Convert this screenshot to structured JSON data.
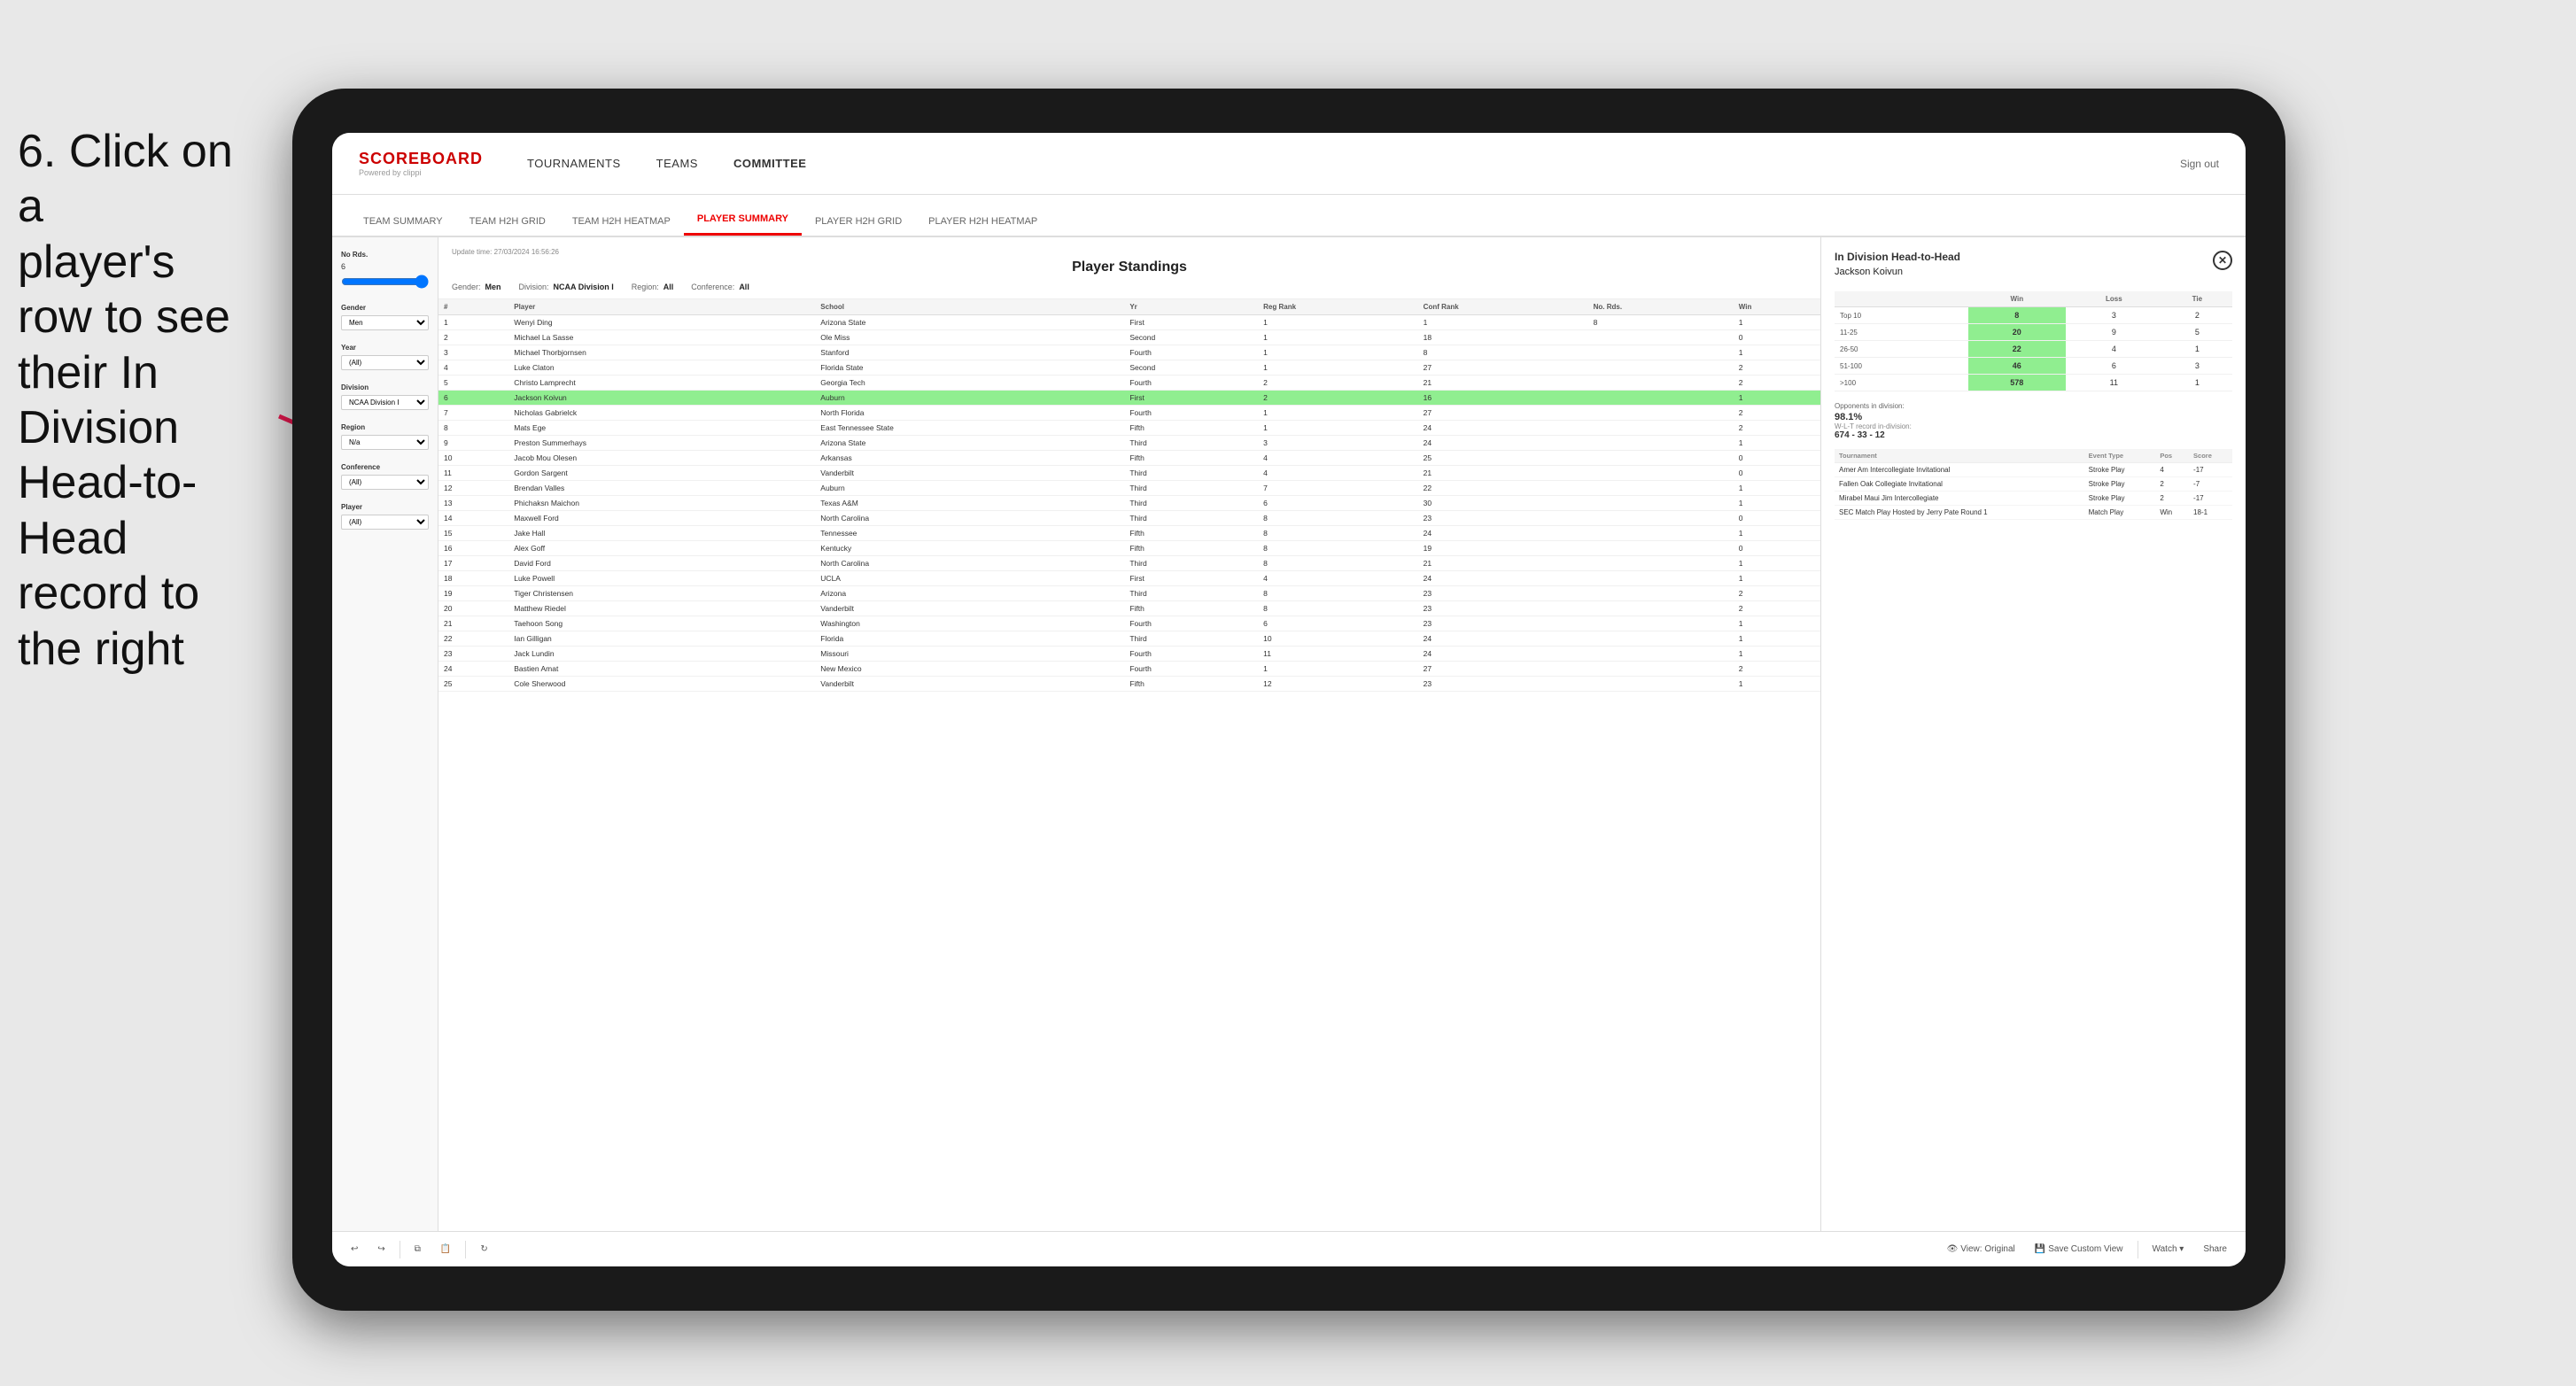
{
  "instruction": {
    "line1": "6. Click on a",
    "line2": "player's row to see",
    "line3": "their In Division",
    "line4": "Head-to-Head",
    "line5": "record to the right"
  },
  "nav": {
    "logo_title": "SCOREBOARD",
    "logo_sub": "Powered by clippi",
    "items": [
      "TOURNAMENTS",
      "TEAMS",
      "COMMITTEE"
    ],
    "sign_out": "Sign out"
  },
  "sub_nav": {
    "items": [
      "TEAM SUMMARY",
      "TEAM H2H GRID",
      "TEAM H2H HEATMAP",
      "PLAYER SUMMARY",
      "PLAYER H2H GRID",
      "PLAYER H2H HEATMAP"
    ],
    "active": "PLAYER SUMMARY"
  },
  "update_time": "Update time: 27/03/2024 16:56:26",
  "table_title": "Player Standings",
  "filters": {
    "gender": "Men",
    "division": "NCAA Division I",
    "region": "All",
    "conference": "All"
  },
  "sidebar_filters": {
    "no_rds": {
      "label": "No Rds.",
      "value": "6",
      "slider_min": 0,
      "slider_max": 1
    },
    "gender": {
      "label": "Gender",
      "value": "Men"
    },
    "year": {
      "label": "Year",
      "value": "(All)"
    },
    "division": {
      "label": "Division",
      "value": "NCAA Division I"
    },
    "region": {
      "label": "Region",
      "value": "N/a"
    },
    "conference": {
      "label": "Conference",
      "value": "(All)"
    },
    "player": {
      "label": "Player",
      "value": "(All)"
    }
  },
  "table_headers": [
    "#",
    "Player",
    "School",
    "Yr",
    "Reg Rank",
    "Conf Rank",
    "No. Rds.",
    "Win"
  ],
  "players": [
    {
      "rank": 1,
      "name": "Wenyi Ding",
      "school": "Arizona State",
      "yr": "First",
      "reg_rank": 1,
      "conf_rank": 1,
      "no_rds": 8,
      "win": 1
    },
    {
      "rank": 2,
      "name": "Michael La Sasse",
      "school": "Ole Miss",
      "yr": "Second",
      "reg_rank": 1,
      "conf_rank": 18,
      "win": 0
    },
    {
      "rank": 3,
      "name": "Michael Thorbjornsen",
      "school": "Stanford",
      "yr": "Fourth",
      "reg_rank": 1,
      "conf_rank": 8,
      "win": 1
    },
    {
      "rank": 4,
      "name": "Luke Claton",
      "school": "Florida State",
      "yr": "Second",
      "reg_rank": 1,
      "conf_rank": 27,
      "win": 2
    },
    {
      "rank": 5,
      "name": "Christo Lamprecht",
      "school": "Georgia Tech",
      "yr": "Fourth",
      "reg_rank": 2,
      "conf_rank": 21,
      "win": 2
    },
    {
      "rank": 6,
      "name": "Jackson Koivun",
      "school": "Auburn",
      "yr": "First",
      "reg_rank": 2,
      "conf_rank": 16,
      "win": 1,
      "highlighted": true
    },
    {
      "rank": 7,
      "name": "Nicholas Gabrielck",
      "school": "North Florida",
      "yr": "Fourth",
      "reg_rank": 1,
      "conf_rank": 27,
      "win": 2
    },
    {
      "rank": 8,
      "name": "Mats Ege",
      "school": "East Tennessee State",
      "yr": "Fifth",
      "reg_rank": 1,
      "conf_rank": 24,
      "win": 2
    },
    {
      "rank": 9,
      "name": "Preston Summerhays",
      "school": "Arizona State",
      "yr": "Third",
      "reg_rank": 3,
      "conf_rank": 24,
      "win": 1
    },
    {
      "rank": 10,
      "name": "Jacob Mou Olesen",
      "school": "Arkansas",
      "yr": "Fifth",
      "reg_rank": 4,
      "conf_rank": 25,
      "win": 0
    },
    {
      "rank": 11,
      "name": "Gordon Sargent",
      "school": "Vanderbilt",
      "yr": "Third",
      "reg_rank": 4,
      "conf_rank": 21,
      "win": 0
    },
    {
      "rank": 12,
      "name": "Brendan Valles",
      "school": "Auburn",
      "yr": "Third",
      "reg_rank": 7,
      "conf_rank": 22,
      "win": 1
    },
    {
      "rank": 13,
      "name": "Phichaksn Maichon",
      "school": "Texas A&M",
      "yr": "Third",
      "reg_rank": 6,
      "conf_rank": 30,
      "win": 1
    },
    {
      "rank": 14,
      "name": "Maxwell Ford",
      "school": "North Carolina",
      "yr": "Third",
      "reg_rank": 8,
      "conf_rank": 23,
      "win": 0
    },
    {
      "rank": 15,
      "name": "Jake Hall",
      "school": "Tennessee",
      "yr": "Fifth",
      "reg_rank": 8,
      "conf_rank": 24,
      "win": 1
    },
    {
      "rank": 16,
      "name": "Alex Goff",
      "school": "Kentucky",
      "yr": "Fifth",
      "reg_rank": 8,
      "conf_rank": 19,
      "win": 0
    },
    {
      "rank": 17,
      "name": "David Ford",
      "school": "North Carolina",
      "yr": "Third",
      "reg_rank": 8,
      "conf_rank": 21,
      "win": 1
    },
    {
      "rank": 18,
      "name": "Luke Powell",
      "school": "UCLA",
      "yr": "First",
      "reg_rank": 4,
      "conf_rank": 24,
      "win": 1
    },
    {
      "rank": 19,
      "name": "Tiger Christensen",
      "school": "Arizona",
      "yr": "Third",
      "reg_rank": 8,
      "conf_rank": 23,
      "win": 2
    },
    {
      "rank": 20,
      "name": "Matthew Riedel",
      "school": "Vanderbilt",
      "yr": "Fifth",
      "reg_rank": 8,
      "conf_rank": 23,
      "win": 2
    },
    {
      "rank": 21,
      "name": "Taehoon Song",
      "school": "Washington",
      "yr": "Fourth",
      "reg_rank": 6,
      "conf_rank": 23,
      "win": 1
    },
    {
      "rank": 22,
      "name": "Ian Gilligan",
      "school": "Florida",
      "yr": "Third",
      "reg_rank": 10,
      "conf_rank": 24,
      "win": 1
    },
    {
      "rank": 23,
      "name": "Jack Lundin",
      "school": "Missouri",
      "yr": "Fourth",
      "reg_rank": 11,
      "conf_rank": 24,
      "win": 1
    },
    {
      "rank": 24,
      "name": "Bastien Amat",
      "school": "New Mexico",
      "yr": "Fourth",
      "reg_rank": 1,
      "conf_rank": 27,
      "win": 2
    },
    {
      "rank": 25,
      "name": "Cole Sherwood",
      "school": "Vanderbilt",
      "yr": "Fifth",
      "reg_rank": 12,
      "conf_rank": 23,
      "win": 1
    }
  ],
  "h2h": {
    "title": "In Division Head-to-Head",
    "player": "Jackson Koivun",
    "columns": [
      "Win",
      "Loss",
      "Tie"
    ],
    "rows": [
      {
        "range": "Top 10",
        "win": 8,
        "loss": 3,
        "tie": 2,
        "win_green": true
      },
      {
        "range": "11-25",
        "win": 20,
        "loss": 9,
        "tie": 5,
        "win_green": true
      },
      {
        "range": "26-50",
        "win": 22,
        "loss": 4,
        "tie": 1,
        "win_green": true
      },
      {
        "range": "51-100",
        "win": 46,
        "loss": 6,
        "tie": 3,
        "win_green": true
      },
      {
        "range": ">100",
        "win": 578,
        "loss": 11,
        "tie": 1,
        "win_green": true
      }
    ],
    "opponents_label": "Opponents in division:",
    "wlt_label": "W-L-T record in-division:",
    "opponents_pct": "98.1%",
    "record": "674 - 33 - 12",
    "tournament_headers": [
      "Tournament",
      "Event Type",
      "Pos",
      "Score"
    ],
    "tournaments": [
      {
        "name": "Amer Am Intercollegiate Invitational",
        "type": "Stroke Play",
        "pos": 4,
        "score": "-17"
      },
      {
        "name": "Fallen Oak Collegiate Invitational",
        "type": "Stroke Play",
        "pos": 2,
        "score": "-7"
      },
      {
        "name": "Mirabel Maui Jim Intercollegiate",
        "type": "Stroke Play",
        "pos": 2,
        "score": "-17"
      },
      {
        "name": "SEC Match Play Hosted by Jerry Pate Round 1",
        "type": "Match Play",
        "pos": "Win",
        "score": "18-1"
      }
    ]
  },
  "toolbar": {
    "undo": "↩",
    "redo": "↪",
    "view_original": "View: Original",
    "save_custom": "Save Custom View",
    "watch": "Watch ▾",
    "share": "Share"
  }
}
